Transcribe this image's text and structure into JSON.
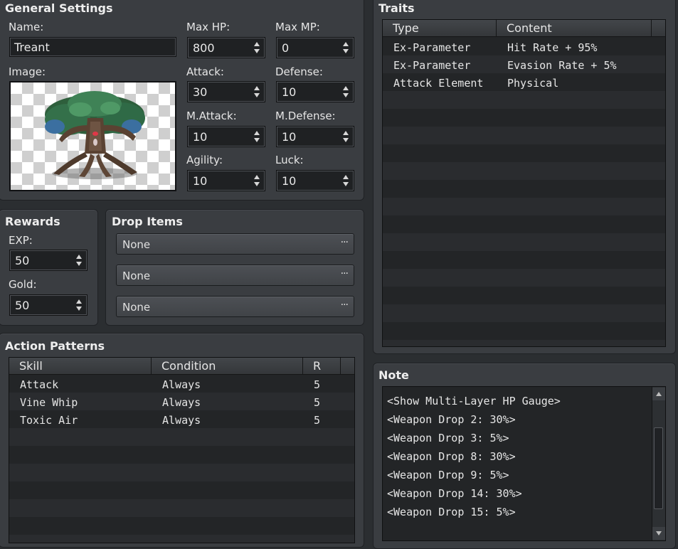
{
  "general": {
    "title": "General Settings",
    "name_label": "Name:",
    "name_value": "Treant",
    "image_label": "Image:",
    "image_icon": "treant-battler",
    "stats": {
      "max_hp": {
        "label": "Max HP:",
        "value": "800"
      },
      "max_mp": {
        "label": "Max MP:",
        "value": "0"
      },
      "attack": {
        "label": "Attack:",
        "value": "30"
      },
      "defense": {
        "label": "Defense:",
        "value": "10"
      },
      "m_attack": {
        "label": "M.Attack:",
        "value": "10"
      },
      "m_defense": {
        "label": "M.Defense:",
        "value": "10"
      },
      "agility": {
        "label": "Agility:",
        "value": "10"
      },
      "luck": {
        "label": "Luck:",
        "value": "10"
      }
    }
  },
  "rewards": {
    "title": "Rewards",
    "exp_label": "EXP:",
    "exp_value": "50",
    "gold_label": "Gold:",
    "gold_value": "50"
  },
  "drop_items": {
    "title": "Drop Items",
    "items": [
      "None",
      "None",
      "None"
    ],
    "more_label": "···"
  },
  "action_patterns": {
    "title": "Action Patterns",
    "headers": [
      "Skill",
      "Condition",
      "R"
    ],
    "rows": [
      {
        "skill": "Attack",
        "condition": "Always",
        "r": "5"
      },
      {
        "skill": "Vine Whip",
        "condition": "Always",
        "r": "5"
      },
      {
        "skill": "Toxic Air",
        "condition": "Always",
        "r": "5"
      }
    ]
  },
  "traits": {
    "title": "Traits",
    "headers": [
      "Type",
      "Content"
    ],
    "rows": [
      {
        "type": "Ex-Parameter",
        "content": "Hit Rate + 95%"
      },
      {
        "type": "Ex-Parameter",
        "content": "Evasion Rate + 5%"
      },
      {
        "type": "Attack Element",
        "content": "Physical"
      }
    ]
  },
  "note": {
    "title": "Note",
    "lines": [
      "<Show Multi-Layer HP Gauge>",
      "<Weapon Drop 2: 30%>",
      "<Weapon Drop 3: 5%>",
      "<Weapon Drop 8: 30%>",
      "<Weapon Drop 9: 5%>",
      "<Weapon Drop 14: 30%>",
      "<Weapon Drop 15: 5%>"
    ]
  }
}
